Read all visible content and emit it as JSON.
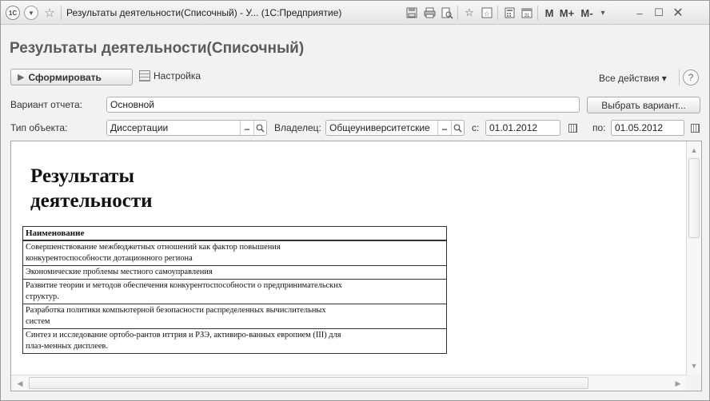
{
  "window": {
    "title": "Результаты деятельности(Списочный) - У... (1С:Предприятие)",
    "logo_text": "1С",
    "memory_buttons": [
      "M",
      "M+",
      "M-"
    ]
  },
  "form": {
    "title": "Результаты деятельности(Списочный)",
    "generate_label": "Сформировать",
    "settings_label": "Настройка",
    "all_actions_label": "Все действия ▾",
    "help_label": "?"
  },
  "filters": {
    "variant_label": "Вариант отчета:",
    "variant_value": "Основной",
    "choose_variant_label": "Выбрать вариант...",
    "object_type_label": "Тип объекта:",
    "object_type_value": "Диссертации",
    "owner_label": "Владелец:",
    "owner_value": "Общеуниверситетские",
    "from_label": "с:",
    "from_value": "01.01.2012",
    "to_label": "по:",
    "to_value": "01.05.2012"
  },
  "report": {
    "title_line1": "Результаты",
    "title_line2": "деятельности",
    "column_header": "Наименование",
    "rows": [
      {
        "line1": "Совершенствование межбюджетных отношений как фактор повышения",
        "line2": "конкурентоспособности дотационного региона"
      },
      {
        "line1": "Экономические проблемы местного самоуправления",
        "line2": ""
      },
      {
        "line1": "Развитие теории и методов обеспечения конкурентоспособности о предпринимательских",
        "line2": "структур."
      },
      {
        "line1": "Разработка политики компьютерной безопасности распределенных вычислительных",
        "line2": "систем"
      },
      {
        "line1": "Синтез и исследование ортобо-рантов иттрия и РЗЭ, активиро-ванных европием (III) для",
        "line2": "плаз-менных дисплеев."
      }
    ]
  },
  "colors": {
    "title_text": "#5b5b5b",
    "border": "#a7a7a7"
  }
}
